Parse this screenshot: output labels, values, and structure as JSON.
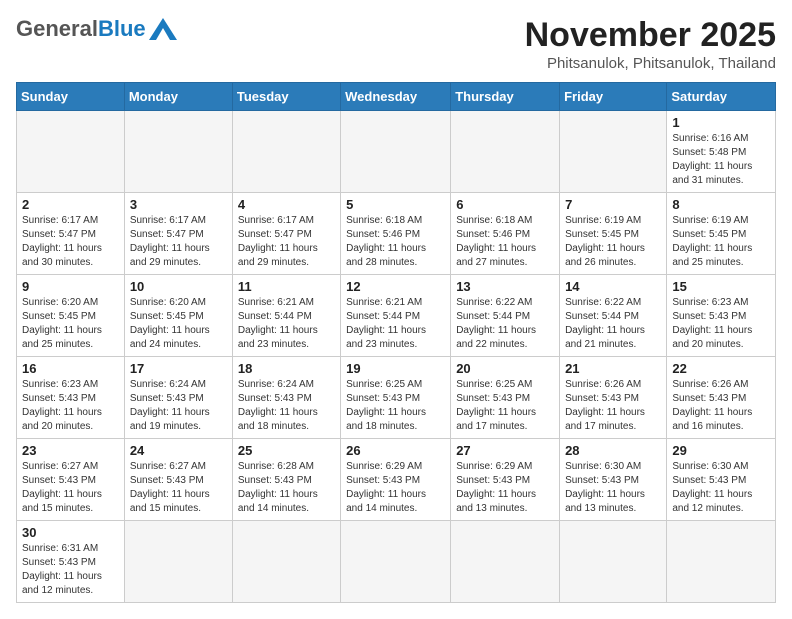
{
  "header": {
    "logo_general": "General",
    "logo_blue": "Blue",
    "month_title": "November 2025",
    "subtitle": "Phitsanulok, Phitsanulok, Thailand"
  },
  "days_of_week": [
    "Sunday",
    "Monday",
    "Tuesday",
    "Wednesday",
    "Thursday",
    "Friday",
    "Saturday"
  ],
  "weeks": [
    [
      {
        "day": "",
        "empty": true
      },
      {
        "day": "",
        "empty": true
      },
      {
        "day": "",
        "empty": true
      },
      {
        "day": "",
        "empty": true
      },
      {
        "day": "",
        "empty": true
      },
      {
        "day": "",
        "empty": true
      },
      {
        "day": "1",
        "sunrise": "Sunrise: 6:16 AM",
        "sunset": "Sunset: 5:48 PM",
        "daylight": "Daylight: 11 hours and 31 minutes."
      }
    ],
    [
      {
        "day": "2",
        "sunrise": "Sunrise: 6:17 AM",
        "sunset": "Sunset: 5:47 PM",
        "daylight": "Daylight: 11 hours and 30 minutes."
      },
      {
        "day": "3",
        "sunrise": "Sunrise: 6:17 AM",
        "sunset": "Sunset: 5:47 PM",
        "daylight": "Daylight: 11 hours and 29 minutes."
      },
      {
        "day": "4",
        "sunrise": "Sunrise: 6:17 AM",
        "sunset": "Sunset: 5:47 PM",
        "daylight": "Daylight: 11 hours and 29 minutes."
      },
      {
        "day": "5",
        "sunrise": "Sunrise: 6:18 AM",
        "sunset": "Sunset: 5:46 PM",
        "daylight": "Daylight: 11 hours and 28 minutes."
      },
      {
        "day": "6",
        "sunrise": "Sunrise: 6:18 AM",
        "sunset": "Sunset: 5:46 PM",
        "daylight": "Daylight: 11 hours and 27 minutes."
      },
      {
        "day": "7",
        "sunrise": "Sunrise: 6:19 AM",
        "sunset": "Sunset: 5:45 PM",
        "daylight": "Daylight: 11 hours and 26 minutes."
      },
      {
        "day": "8",
        "sunrise": "Sunrise: 6:19 AM",
        "sunset": "Sunset: 5:45 PM",
        "daylight": "Daylight: 11 hours and 25 minutes."
      }
    ],
    [
      {
        "day": "9",
        "sunrise": "Sunrise: 6:20 AM",
        "sunset": "Sunset: 5:45 PM",
        "daylight": "Daylight: 11 hours and 25 minutes."
      },
      {
        "day": "10",
        "sunrise": "Sunrise: 6:20 AM",
        "sunset": "Sunset: 5:45 PM",
        "daylight": "Daylight: 11 hours and 24 minutes."
      },
      {
        "day": "11",
        "sunrise": "Sunrise: 6:21 AM",
        "sunset": "Sunset: 5:44 PM",
        "daylight": "Daylight: 11 hours and 23 minutes."
      },
      {
        "day": "12",
        "sunrise": "Sunrise: 6:21 AM",
        "sunset": "Sunset: 5:44 PM",
        "daylight": "Daylight: 11 hours and 23 minutes."
      },
      {
        "day": "13",
        "sunrise": "Sunrise: 6:22 AM",
        "sunset": "Sunset: 5:44 PM",
        "daylight": "Daylight: 11 hours and 22 minutes."
      },
      {
        "day": "14",
        "sunrise": "Sunrise: 6:22 AM",
        "sunset": "Sunset: 5:44 PM",
        "daylight": "Daylight: 11 hours and 21 minutes."
      },
      {
        "day": "15",
        "sunrise": "Sunrise: 6:23 AM",
        "sunset": "Sunset: 5:43 PM",
        "daylight": "Daylight: 11 hours and 20 minutes."
      }
    ],
    [
      {
        "day": "16",
        "sunrise": "Sunrise: 6:23 AM",
        "sunset": "Sunset: 5:43 PM",
        "daylight": "Daylight: 11 hours and 20 minutes."
      },
      {
        "day": "17",
        "sunrise": "Sunrise: 6:24 AM",
        "sunset": "Sunset: 5:43 PM",
        "daylight": "Daylight: 11 hours and 19 minutes."
      },
      {
        "day": "18",
        "sunrise": "Sunrise: 6:24 AM",
        "sunset": "Sunset: 5:43 PM",
        "daylight": "Daylight: 11 hours and 18 minutes."
      },
      {
        "day": "19",
        "sunrise": "Sunrise: 6:25 AM",
        "sunset": "Sunset: 5:43 PM",
        "daylight": "Daylight: 11 hours and 18 minutes."
      },
      {
        "day": "20",
        "sunrise": "Sunrise: 6:25 AM",
        "sunset": "Sunset: 5:43 PM",
        "daylight": "Daylight: 11 hours and 17 minutes."
      },
      {
        "day": "21",
        "sunrise": "Sunrise: 6:26 AM",
        "sunset": "Sunset: 5:43 PM",
        "daylight": "Daylight: 11 hours and 17 minutes."
      },
      {
        "day": "22",
        "sunrise": "Sunrise: 6:26 AM",
        "sunset": "Sunset: 5:43 PM",
        "daylight": "Daylight: 11 hours and 16 minutes."
      }
    ],
    [
      {
        "day": "23",
        "sunrise": "Sunrise: 6:27 AM",
        "sunset": "Sunset: 5:43 PM",
        "daylight": "Daylight: 11 hours and 15 minutes."
      },
      {
        "day": "24",
        "sunrise": "Sunrise: 6:27 AM",
        "sunset": "Sunset: 5:43 PM",
        "daylight": "Daylight: 11 hours and 15 minutes."
      },
      {
        "day": "25",
        "sunrise": "Sunrise: 6:28 AM",
        "sunset": "Sunset: 5:43 PM",
        "daylight": "Daylight: 11 hours and 14 minutes."
      },
      {
        "day": "26",
        "sunrise": "Sunrise: 6:29 AM",
        "sunset": "Sunset: 5:43 PM",
        "daylight": "Daylight: 11 hours and 14 minutes."
      },
      {
        "day": "27",
        "sunrise": "Sunrise: 6:29 AM",
        "sunset": "Sunset: 5:43 PM",
        "daylight": "Daylight: 11 hours and 13 minutes."
      },
      {
        "day": "28",
        "sunrise": "Sunrise: 6:30 AM",
        "sunset": "Sunset: 5:43 PM",
        "daylight": "Daylight: 11 hours and 13 minutes."
      },
      {
        "day": "29",
        "sunrise": "Sunrise: 6:30 AM",
        "sunset": "Sunset: 5:43 PM",
        "daylight": "Daylight: 11 hours and 12 minutes."
      }
    ],
    [
      {
        "day": "30",
        "sunrise": "Sunrise: 6:31 AM",
        "sunset": "Sunset: 5:43 PM",
        "daylight": "Daylight: 11 hours and 12 minutes."
      },
      {
        "day": "",
        "empty": true
      },
      {
        "day": "",
        "empty": true
      },
      {
        "day": "",
        "empty": true
      },
      {
        "day": "",
        "empty": true
      },
      {
        "day": "",
        "empty": true
      },
      {
        "day": "",
        "empty": true
      }
    ]
  ]
}
